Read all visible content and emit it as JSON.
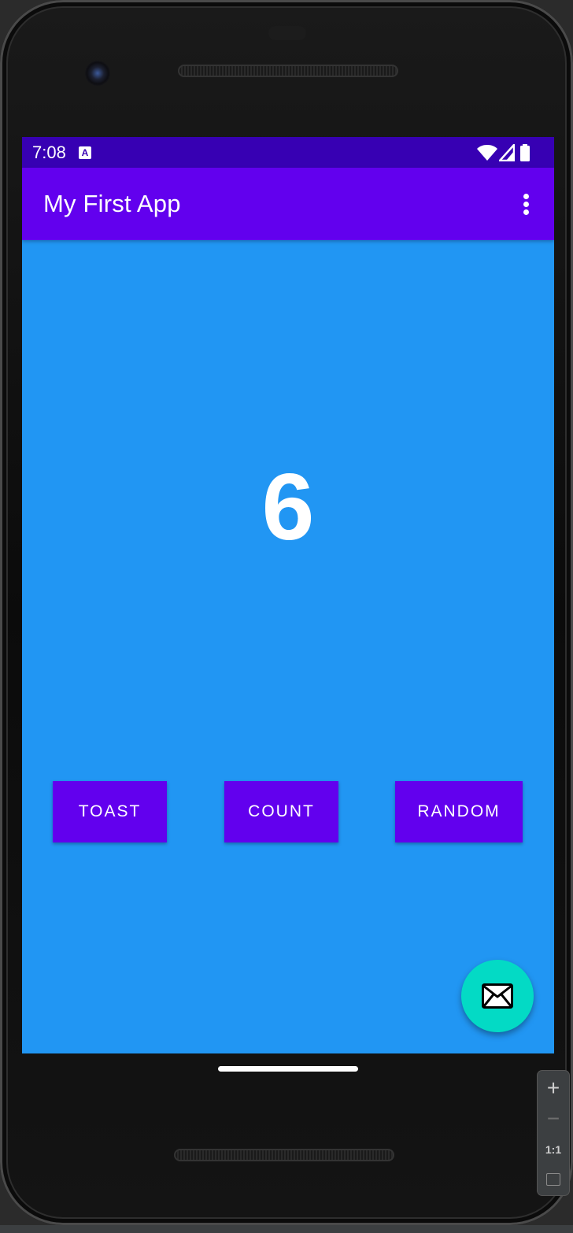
{
  "status_bar": {
    "time": "7:08",
    "notification_icon": "A",
    "icons": [
      "wifi-icon",
      "cellular-signal-icon",
      "battery-icon"
    ],
    "color": "#3700b3"
  },
  "app_bar": {
    "title": "My First App",
    "overflow_icon": "more-vert-icon",
    "color": "#6200ee"
  },
  "main": {
    "count": "6",
    "background": "#2196f3"
  },
  "buttons": {
    "toast": "TOAST",
    "count": "COUNT",
    "random": "RANDOM"
  },
  "fab": {
    "icon": "email-icon",
    "color": "#03dac5"
  },
  "zoom_panel": {
    "zoom_in": "+",
    "zoom_out": "−",
    "actual_size": "1:1",
    "fit_icon": "fit-screen-icon"
  }
}
